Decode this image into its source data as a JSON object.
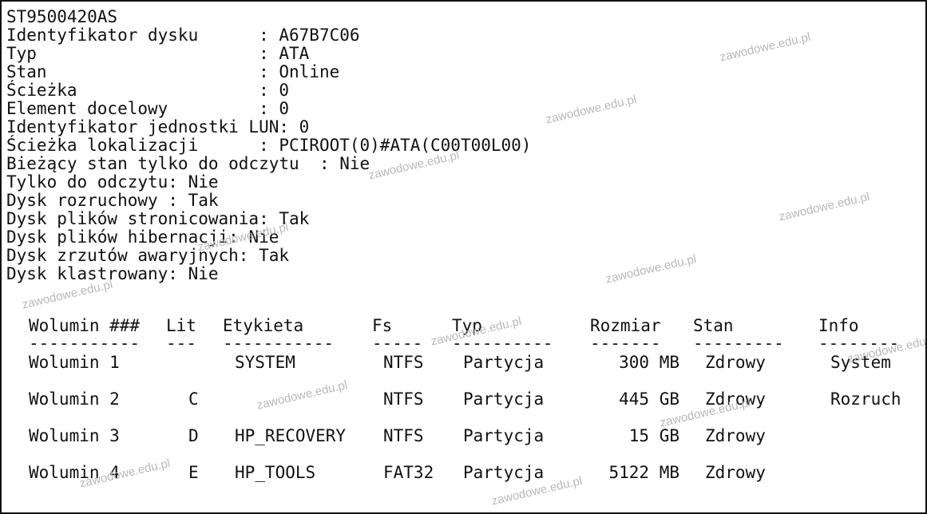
{
  "disk": {
    "model": "ST9500420AS",
    "properties": [
      {
        "label": "Identyfikator dysku",
        "pad": "      ",
        "sep": ": ",
        "value": "A67B7C06"
      },
      {
        "label": "Typ",
        "pad": "                      ",
        "sep": ": ",
        "value": "ATA"
      },
      {
        "label": "Stan",
        "pad": "                     ",
        "sep": ": ",
        "value": "Online"
      },
      {
        "label": "Ścieżka",
        "pad": "                  ",
        "sep": ": ",
        "value": "0"
      },
      {
        "label": "Element docelowy",
        "pad": "         ",
        "sep": ": ",
        "value": "0"
      },
      {
        "label": "Identyfikator jednostki LUN",
        "pad": "",
        "sep": ": ",
        "value": "0"
      },
      {
        "label": "Ścieżka lokalizacji",
        "pad": "      ",
        "sep": ": ",
        "value": "PCIROOT(0)#ATA(C00T00L00)"
      },
      {
        "label": "Bieżący stan tylko do odczytu",
        "pad": "  ",
        "sep": ": ",
        "value": "Nie"
      },
      {
        "label": "Tylko do odczytu",
        "pad": "",
        "sep": ": ",
        "value": "Nie"
      },
      {
        "label": "Dysk rozruchowy",
        "pad": " ",
        "sep": ": ",
        "value": "Tak"
      },
      {
        "label": "Dysk plików stronicowania",
        "pad": "",
        "sep": ": ",
        "value": "Tak"
      },
      {
        "label": "Dysk plików hibernacji",
        "pad": "",
        "sep": ": ",
        "value": "Nie"
      },
      {
        "label": "Dysk zrzutów awaryjnych",
        "pad": "",
        "sep": ": ",
        "value": "Tak"
      },
      {
        "label": "Dysk klastrowany",
        "pad": "",
        "sep": ": ",
        "value": "Nie"
      }
    ]
  },
  "volumes": {
    "headers": [
      "Wolumin ###",
      "Lit",
      "Etykieta",
      "Fs",
      "Typ",
      "Rozmiar",
      "Stan",
      "Info"
    ],
    "separators": [
      "-----------",
      "---",
      "-----------",
      "-----",
      "----------",
      "-------",
      "---------",
      "--------"
    ],
    "rows": [
      {
        "name": "Wolumin 1",
        "letter": "",
        "label": "SYSTEM",
        "fs": "NTFS",
        "type": "Partycja",
        "size": "300 MB",
        "status": "Zdrowy",
        "info": "System"
      },
      {
        "name": "Wolumin 2",
        "letter": "C",
        "label": "",
        "fs": "NTFS",
        "type": "Partycja",
        "size": "445 GB",
        "status": "Zdrowy",
        "info": "Rozruch"
      },
      {
        "name": "Wolumin 3",
        "letter": "D",
        "label": "HP_RECOVERY",
        "fs": "NTFS",
        "type": "Partycja",
        "size": "15 GB",
        "status": "Zdrowy",
        "info": ""
      },
      {
        "name": "Wolumin 4",
        "letter": "E",
        "label": "HP_TOOLS",
        "fs": "FAT32",
        "type": "Partycja",
        "size": "5122 MB",
        "status": "Zdrowy",
        "info": ""
      }
    ]
  },
  "watermark": {
    "text": "zawodowe.edu.pl",
    "color": "#b9b9b9"
  }
}
